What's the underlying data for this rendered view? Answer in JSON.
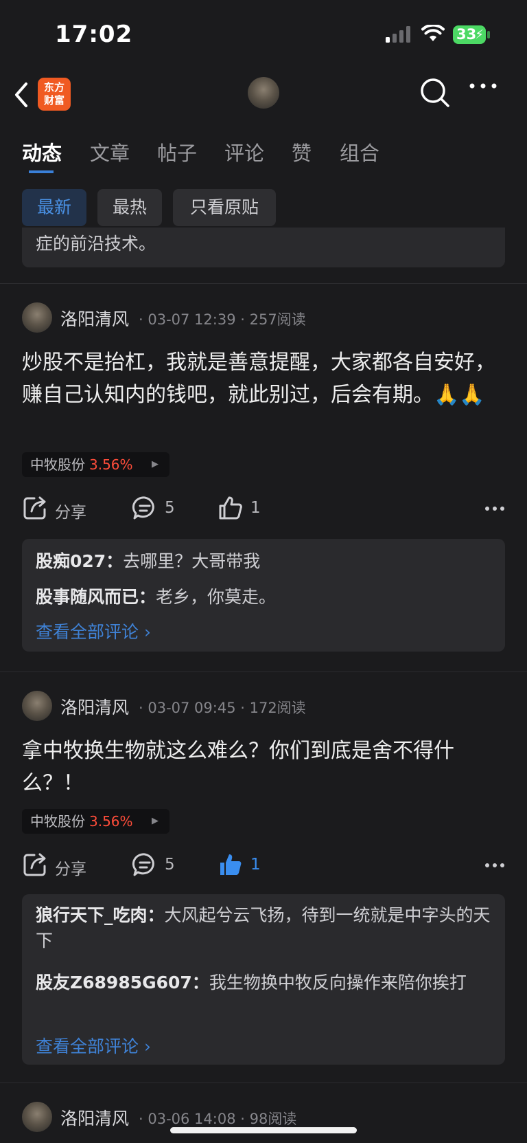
{
  "status_bar": {
    "time": "17:02",
    "battery": "33"
  },
  "app": {
    "logo_line1": "东方",
    "logo_line2": "财富"
  },
  "tabs": [
    {
      "label": "动态"
    },
    {
      "label": "文章"
    },
    {
      "label": "帖子"
    },
    {
      "label": "评论"
    },
    {
      "label": "赞"
    },
    {
      "label": "组合"
    }
  ],
  "filters": [
    {
      "label": "最新"
    },
    {
      "label": "最热"
    },
    {
      "label": "只看原贴"
    }
  ],
  "partial_post": {
    "text": "症的前沿技术。"
  },
  "posts": [
    {
      "username": "洛阳清风",
      "meta": "· 03-07 12:39 · 257阅读",
      "content": "炒股不是抬杠，我就是善意提醒，大家都各自安好，赚自己认知内的钱吧，就此别过，后会有期。🙏🙏",
      "stock_name": "中牧股份",
      "stock_change": "3.56%",
      "share_label": "分享",
      "comment_count": "5",
      "like_count": "1",
      "liked": false,
      "comments": [
        {
          "user": "股痴027：",
          "text": "去哪里？大哥带我"
        },
        {
          "user": "股事随风而已：",
          "text": "老乡，你莫走。"
        }
      ],
      "view_all": "查看全部评论 ›"
    },
    {
      "username": "洛阳清风",
      "meta": "· 03-07 09:45 · 172阅读",
      "content": "拿中牧换生物就这么难么？你们到底是舍不得什么？！",
      "stock_name": "中牧股份",
      "stock_change": "3.56%",
      "share_label": "分享",
      "comment_count": "5",
      "like_count": "1",
      "liked": true,
      "comments": [
        {
          "user": "狼行天下_吃肉：",
          "text": "大风起兮云飞扬，待到一统就是中字头的天下"
        },
        {
          "user": "股友Z68985G607：",
          "text": "我生物换中牧反向操作来陪你挨打"
        }
      ],
      "view_all": "查看全部评论 ›"
    },
    {
      "username": "洛阳清风",
      "meta": "· 03-06 14:08 · 98阅读"
    }
  ]
}
